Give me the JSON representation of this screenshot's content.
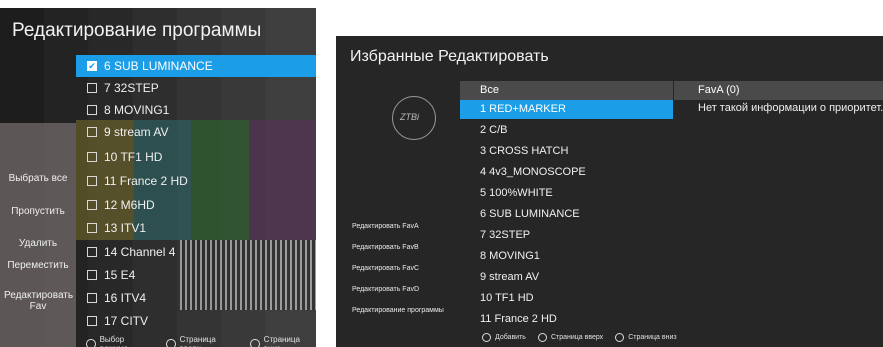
{
  "left_screen": {
    "title": "Редактирование программы",
    "channels": [
      {
        "label": "6 SUB LUMINANCE",
        "checked": true,
        "selected": true
      },
      {
        "label": "7 32STEP",
        "checked": false,
        "selected": false
      },
      {
        "label": "8 MOVING1",
        "checked": false,
        "selected": false
      },
      {
        "label": "9 stream AV",
        "checked": false,
        "selected": false
      },
      {
        "label": "10 TF1 HD",
        "checked": false,
        "selected": false
      },
      {
        "label": "11 France 2 HD",
        "checked": false,
        "selected": false
      },
      {
        "label": "12 M6HD",
        "checked": false,
        "selected": false
      },
      {
        "label": "13 ITV1",
        "checked": false,
        "selected": false
      },
      {
        "label": "14 Channel 4",
        "checked": false,
        "selected": false
      },
      {
        "label": "15 E4",
        "checked": false,
        "selected": false
      },
      {
        "label": "16 ITV4",
        "checked": false,
        "selected": false
      },
      {
        "label": "17 CITV",
        "checked": false,
        "selected": false
      }
    ],
    "side_menu": [
      "Выбрать все",
      "Пропустить",
      "Удалить",
      "Переместить",
      "Редактировать Fav"
    ],
    "footer": [
      "Выбор режима",
      "Страница вверх",
      "Страница вниз"
    ]
  },
  "right_screen": {
    "title": "Избранные Редактировать",
    "list_header": "Все",
    "fav_header": "FavA (0)",
    "fav_info": "Нет такой информации о приоритет..",
    "channels": [
      {
        "label": "1 RED+MARKER",
        "selected": true
      },
      {
        "label": "2 C/B",
        "selected": false
      },
      {
        "label": "3 CROSS HATCH",
        "selected": false
      },
      {
        "label": "4 4v3_MONOSCOPE",
        "selected": false
      },
      {
        "label": "5 100%WHITE",
        "selected": false
      },
      {
        "label": "6 SUB LUMINANCE",
        "selected": false
      },
      {
        "label": "7 32STEP",
        "selected": false
      },
      {
        "label": "8 MOVING1",
        "selected": false
      },
      {
        "label": "9 stream AV",
        "selected": false
      },
      {
        "label": "10 TF1 HD",
        "selected": false
      },
      {
        "label": "11 France 2 HD",
        "selected": false
      }
    ],
    "side_menu": [
      "Редактировать FavA",
      "Редактировать FavB",
      "Редактировать FavC",
      "Редактировать FavD",
      "Редактирование программы"
    ],
    "footer": [
      "Добавить",
      "Страница вверх",
      "Страница вниз"
    ]
  }
}
